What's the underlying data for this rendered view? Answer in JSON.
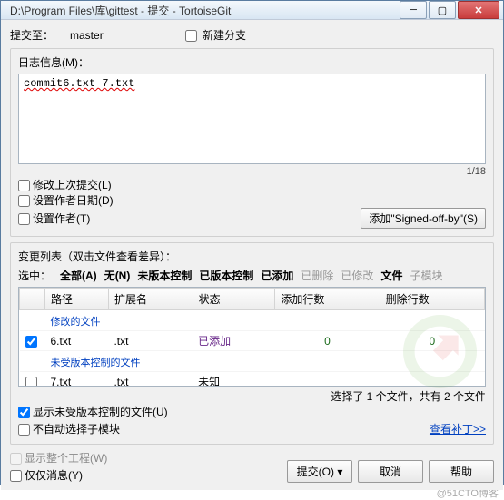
{
  "window": {
    "title": "D:\\Program Files\\库\\gittest - 提交 - TortoiseGit"
  },
  "header": {
    "commit_to_label": "提交至：",
    "branch": "master",
    "new_branch_label": "新建分支"
  },
  "log": {
    "legend": "日志信息(M)：",
    "message": "commit6.txt 7.txt",
    "counter": "1/18",
    "chk_amend": "修改上次提交(L)",
    "chk_set_date": "设置作者日期(D)",
    "chk_set_author": "设置作者(T)",
    "signed_off_btn": "添加\"Signed-off-by\"(S)"
  },
  "changes": {
    "legend": "变更列表（双击文件查看差异）：",
    "select_label": "选中：",
    "filters": {
      "all": "全部(A)",
      "none": "无(N)",
      "unversioned": "未版本控制",
      "versioned": "已版本控制",
      "added": "已添加",
      "deleted": "已删除",
      "modified": "已修改",
      "files": "文件",
      "submodules": "子模块"
    },
    "columns": {
      "path": "路径",
      "ext": "扩展名",
      "status": "状态",
      "add_lines": "添加行数",
      "del_lines": "删除行数"
    },
    "group_modified": "修改的文件",
    "group_unversioned": "未受版本控制的文件",
    "rows": [
      {
        "checked": true,
        "path": "6.txt",
        "ext": ".txt",
        "status": "已添加",
        "add": "0",
        "del": "0"
      },
      {
        "checked": false,
        "path": "7.txt",
        "ext": ".txt",
        "status": "未知",
        "add": "",
        "del": ""
      }
    ],
    "sel_info": "选择了 1 个文件，共有 2 个文件",
    "chk_show_unversioned": "显示未受版本控制的文件(U)",
    "chk_no_auto_submodule": "不自动选择子模块",
    "view_patch_link": "查看补丁>>"
  },
  "footer": {
    "chk_whole_project": "显示整个工程(W)",
    "chk_msg_only": "仅仅消息(Y)",
    "commit_btn": "提交(O)",
    "cancel_btn": "取消",
    "help_btn": "帮助"
  },
  "watermark": "@51CTO博客"
}
